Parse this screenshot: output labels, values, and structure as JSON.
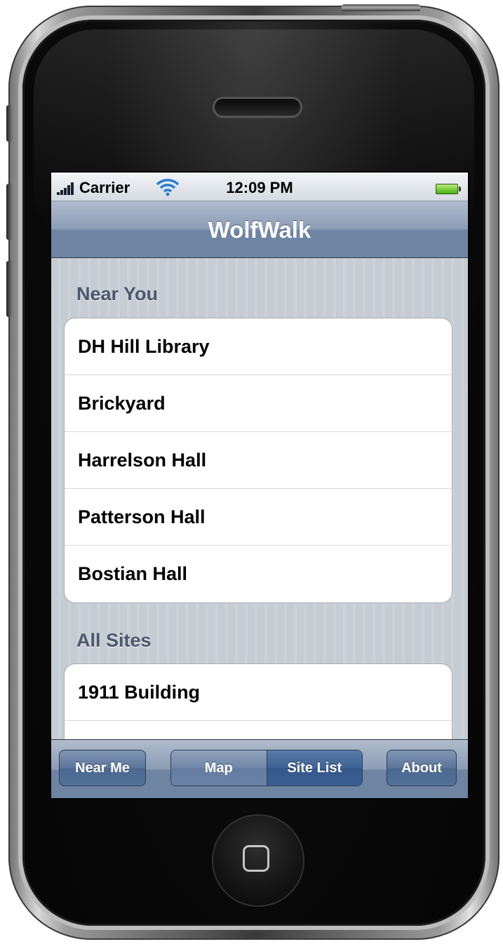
{
  "status_bar": {
    "carrier": "Carrier",
    "time": "12:09 PM",
    "signal_icon": "signal-bars-icon",
    "wifi_icon": "wifi-icon",
    "battery_icon": "battery-icon",
    "battery_color": "#47b30e"
  },
  "nav": {
    "title": "WolfWalk"
  },
  "sections": [
    {
      "header": "Near You",
      "items": [
        "DH Hill Library",
        "Brickyard",
        "Harrelson Hall",
        "Patterson Hall",
        "Bostian Hall"
      ]
    },
    {
      "header": "All Sites",
      "items": [
        "1911 Building",
        ""
      ]
    }
  ],
  "toolbar": {
    "near_me": "Near Me",
    "map": "Map",
    "site_list": "Site List",
    "about": "About",
    "selected_segment": "Site List",
    "accent_color": "#6d84a2"
  },
  "device": {
    "home_button_icon": "home-square-icon"
  }
}
